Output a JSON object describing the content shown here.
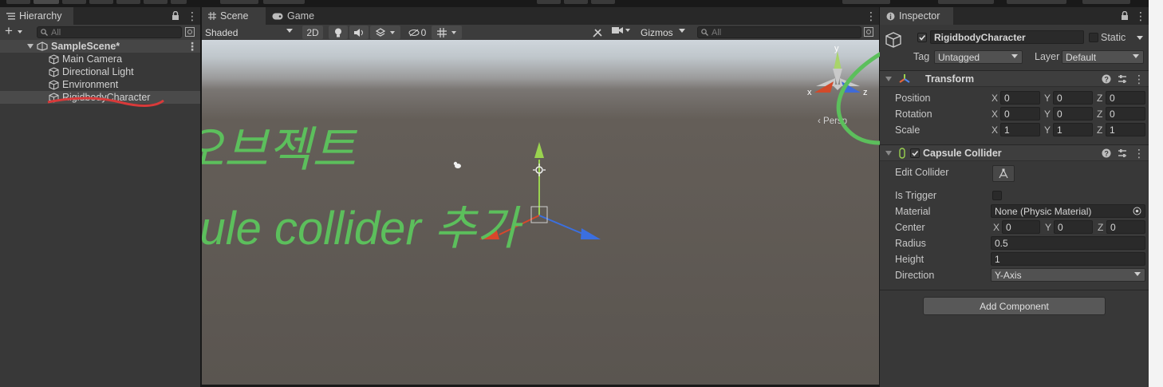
{
  "hierarchy": {
    "tab_label": "Hierarchy",
    "search_placeholder": "All",
    "add_label": "+",
    "scene_name": "SampleScene*",
    "items": [
      {
        "label": "Main Camera"
      },
      {
        "label": "Directional Light"
      },
      {
        "label": "Environment"
      },
      {
        "label": "RigidbodyCharacter"
      }
    ]
  },
  "scene_view": {
    "tabs": [
      {
        "label": "Scene"
      },
      {
        "label": "Game"
      }
    ],
    "shading_mode": "Shaded",
    "mode_2d": "2D",
    "hidden_count": "0",
    "gizmos_label": "Gizmos",
    "search_placeholder": "All",
    "persp_label": "Persp",
    "axis_labels": {
      "x": "x",
      "y": "y",
      "z": "z"
    }
  },
  "annotations": {
    "line1": "빈 게임오브젝트",
    "line2": "+ capsule collider 추가",
    "ink_color": "#5cbf5c",
    "mark_color": "#d83a3a"
  },
  "inspector": {
    "tab_label": "Inspector",
    "object_name": "RigidbodyCharacter",
    "static_label": "Static",
    "tag_label": "Tag",
    "tag_value": "Untagged",
    "layer_label": "Layer",
    "layer_value": "Default",
    "transform": {
      "title": "Transform",
      "position": {
        "label": "Position",
        "x": "0",
        "y": "0",
        "z": "0"
      },
      "rotation": {
        "label": "Rotation",
        "x": "0",
        "y": "0",
        "z": "0"
      },
      "scale": {
        "label": "Scale",
        "x": "1",
        "y": "1",
        "z": "1"
      }
    },
    "capsule": {
      "title": "Capsule Collider",
      "edit_collider": "Edit Collider",
      "is_trigger": "Is Trigger",
      "material_label": "Material",
      "material_value": "None (Physic Material)",
      "center": {
        "label": "Center",
        "x": "0",
        "y": "0",
        "z": "0"
      },
      "radius": {
        "label": "Radius",
        "value": "0.5"
      },
      "height": {
        "label": "Height",
        "value": "1"
      },
      "direction": {
        "label": "Direction",
        "value": "Y-Axis"
      }
    },
    "add_component": "Add Component",
    "axis_letters": {
      "x": "X",
      "y": "Y",
      "z": "Z"
    }
  }
}
